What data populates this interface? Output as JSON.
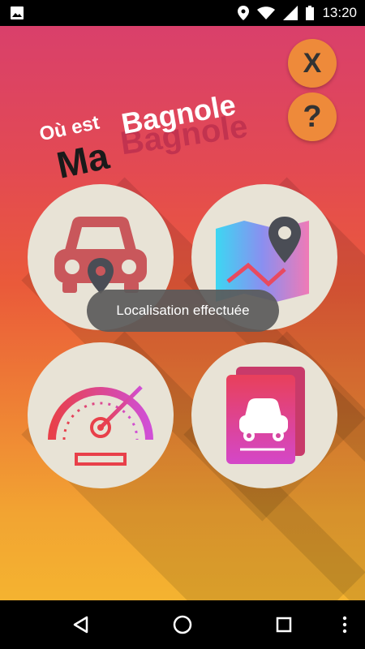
{
  "status_bar": {
    "time": "13:20",
    "icons": [
      "image-icon",
      "location-icon",
      "wifi-icon",
      "signal-icon",
      "battery-icon"
    ]
  },
  "app": {
    "logo": {
      "line1": "Où est",
      "line2": "Ma",
      "line3": "Bagnole"
    },
    "buttons": {
      "close_label": "X",
      "help_label": "?"
    },
    "tiles": [
      {
        "icon": "car-location-icon"
      },
      {
        "icon": "map-pin-icon"
      },
      {
        "icon": "speedometer-icon"
      },
      {
        "icon": "car-papers-icon"
      }
    ],
    "toast": "Localisation effectuée",
    "colors": {
      "gradient_top": "#d9406b",
      "gradient_bottom": "#f4b330",
      "tile_bg": "#e8e3d6",
      "round_btn": "#ee8a3a"
    }
  },
  "nav_bar": {
    "buttons": [
      "back-icon",
      "home-icon",
      "recents-icon",
      "more-icon"
    ]
  }
}
